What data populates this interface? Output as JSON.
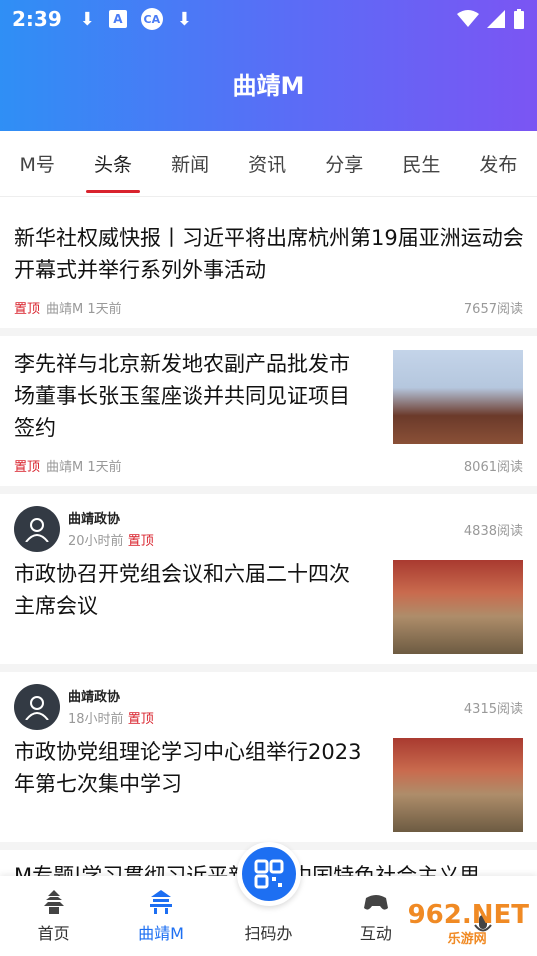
{
  "status": {
    "time": "2:39",
    "icon_a": "A",
    "icon_ca": "CA"
  },
  "header": {
    "title": "曲靖M"
  },
  "tabs": [
    "M号",
    "头条",
    "新闻",
    "资讯",
    "分享",
    "民生",
    "发布"
  ],
  "active_tab": "头条",
  "feed": [
    {
      "title": "新华社权威快报丨习近平将出席杭州第19届亚洲运动会开幕式并举行系列外事活动",
      "pin": "置顶",
      "source": "曲靖M",
      "time": "1天前",
      "reads": "7657阅读"
    },
    {
      "title": "李先祥与北京新发地农副产品批发市场董事长张玉玺座谈并共同见证项目签约",
      "pin": "置顶",
      "source": "曲靖M",
      "time": "1天前",
      "reads": "8061阅读"
    },
    {
      "author": "曲靖政协",
      "time": "20小时前",
      "pin": "置顶",
      "reads": "4838阅读",
      "title": "市政协召开党组会议和六届二十四次主席会议"
    },
    {
      "author": "曲靖政协",
      "time": "18小时前",
      "pin": "置顶",
      "reads": "4315阅读",
      "title": "市政协党组理论学习中心组举行2023年第七次集中学习"
    }
  ],
  "partial_title": "M专题|学习贯彻习近平新时代中国特色社会主义思",
  "bottom_nav": {
    "home": "首页",
    "qujing": "曲靖M",
    "scan": "扫码办",
    "interact": "互动"
  },
  "watermark": {
    "main": "962.NET",
    "sub": "乐游网"
  },
  "colors": {
    "accent": "#1d6ff2",
    "pin": "#d9232d"
  }
}
